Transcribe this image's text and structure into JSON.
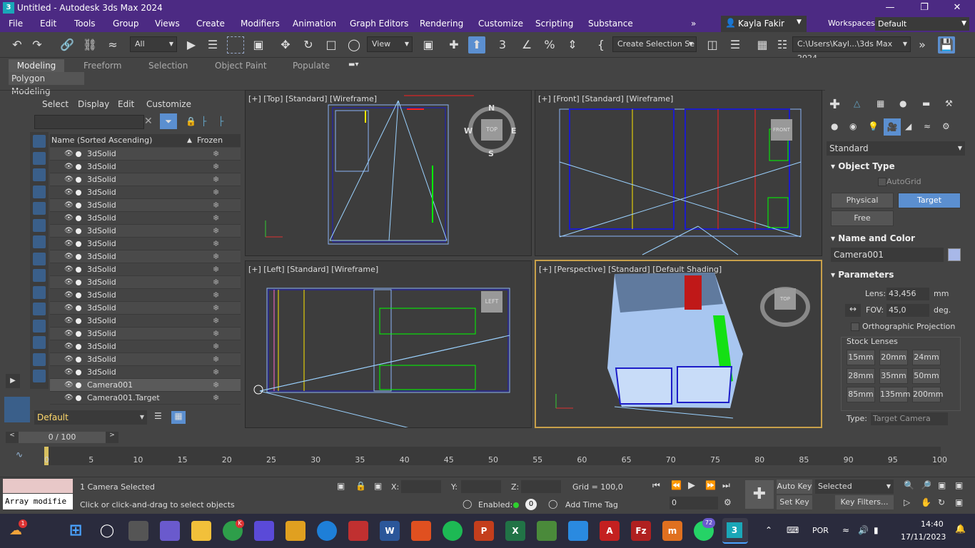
{
  "window": {
    "title": "Untitled - Autodesk 3ds Max 2024",
    "app_icon": "3ds-max-icon"
  },
  "menu": [
    "File",
    "Edit",
    "Tools",
    "Group",
    "Views",
    "Create",
    "Modifiers",
    "Animation",
    "Graph Editors",
    "Rendering",
    "Customize",
    "Scripting",
    "Substance"
  ],
  "user": "Kayla Fakir",
  "workspaces": {
    "label": "Workspaces:",
    "value": "Default"
  },
  "toolbar": {
    "filter": "All",
    "ref_coord": "View",
    "selection_set": "Create Selection Se",
    "path": "C:\\Users\\Kayl...\\3ds Max 2024"
  },
  "ribbon": {
    "tabs": [
      "Modeling",
      "Freeform",
      "Selection",
      "Object Paint",
      "Populate"
    ],
    "active": "Modeling",
    "panel": "Polygon Modeling"
  },
  "scene_explorer": {
    "tabs": [
      "Select",
      "Display",
      "Edit",
      "Customize"
    ],
    "col_name": "Name (Sorted Ascending)",
    "col_sort": "▲",
    "col_frozen": "Frozen",
    "rows": [
      "3dSolid",
      "3dSolid",
      "3dSolid",
      "3dSolid",
      "3dSolid",
      "3dSolid",
      "3dSolid",
      "3dSolid",
      "3dSolid",
      "3dSolid",
      "3dSolid",
      "3dSolid",
      "3dSolid",
      "3dSolid",
      "3dSolid",
      "3dSolid",
      "3dSolid",
      "3dSolid",
      "Camera001",
      "Camera001.Target"
    ],
    "layer": "Default"
  },
  "viewports": {
    "top": "[+] [Top] [Standard] [Wireframe]",
    "front": "[+] [Front] [Standard] [Wireframe]",
    "left": "[+] [Left] [Standard] [Wireframe]",
    "persp": "[+] [Perspective] [Standard] [Default Shading]",
    "cube_top": "TOP",
    "cube_front": "FRONT",
    "cube_left": "LEFT",
    "compass": {
      "n": "N",
      "s": "S",
      "e": "E",
      "w": "W"
    }
  },
  "command_panel": {
    "category": "Standard",
    "object_type": "Object Type",
    "autogrid": "AutoGrid",
    "buttons": [
      "Physical",
      "Target",
      "Free"
    ],
    "active_button": "Target",
    "name_color": "Name and Color",
    "object_name": "Camera001",
    "object_color": "#a8b8e8",
    "parameters": "Parameters",
    "lens_label": "Lens:",
    "lens": "43,456",
    "lens_unit": "mm",
    "fov_label": "FOV:",
    "fov": "45,0",
    "fov_unit": "deg.",
    "ortho": "Orthographic Projection",
    "stock": "Stock Lenses",
    "lenses": [
      "15mm",
      "20mm",
      "24mm",
      "28mm",
      "35mm",
      "50mm",
      "85mm",
      "135mm",
      "200mm"
    ],
    "type_label": "Type:",
    "type": "Target Camera"
  },
  "timeline": {
    "frame": "0 / 100",
    "ticks": [
      "0",
      "5",
      "10",
      "15",
      "20",
      "25",
      "30",
      "35",
      "40",
      "45",
      "50",
      "55",
      "60",
      "65",
      "70",
      "75",
      "80",
      "85",
      "90",
      "95",
      "100"
    ]
  },
  "status": {
    "maxscript": "Array modifie",
    "selected": "1 Camera Selected",
    "prompt": "Click or click-and-drag to select objects",
    "x": "X:",
    "y": "Y:",
    "z": "Z:",
    "grid": "Grid = 100,0",
    "enabled": "Enabled:",
    "enabled_val": "0",
    "timetag": "Add Time Tag",
    "autokey": "Auto Key",
    "setkey": "Set Key",
    "selected_dd": "Selected",
    "keyfilters": "Key Filters...",
    "frame_field": "0"
  },
  "taskbar": {
    "lang": "POR",
    "time": "14:40",
    "date": "17/11/2023",
    "badge_weather": "1",
    "badge_chrome": "K",
    "badge_whatsapp": "72",
    "max_label": "3"
  }
}
